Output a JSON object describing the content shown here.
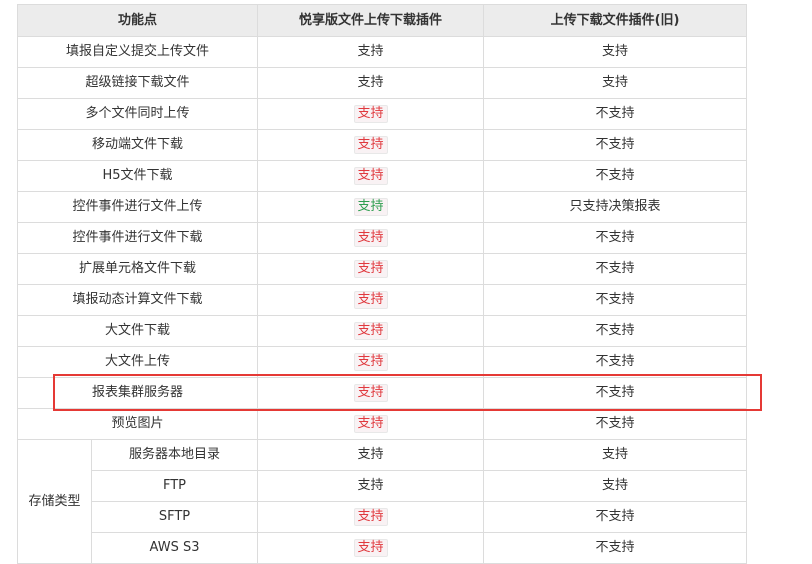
{
  "colors": {
    "text": "#333333",
    "red_support": "#e0393e",
    "green_support": "#2e9e4f",
    "header_bg": "#ececec",
    "border": "#dcdcdc",
    "highlight_box": "#e53935"
  },
  "table": {
    "headers": [
      "功能点",
      "悦享版文件上传下载插件",
      "上传下载文件插件(旧)"
    ],
    "rows": [
      {
        "feature": "填报自定义提交上传文件",
        "new": "支持",
        "new_style": "plain",
        "old": "支持"
      },
      {
        "feature": "超级链接下载文件",
        "new": "支持",
        "new_style": "plain",
        "old": "支持"
      },
      {
        "feature": "多个文件同时上传",
        "new": "支持",
        "new_style": "red",
        "old": "不支持"
      },
      {
        "feature": "移动端文件下载",
        "new": "支持",
        "new_style": "red",
        "old": "不支持"
      },
      {
        "feature": "H5文件下载",
        "new": "支持",
        "new_style": "red",
        "old": "不支持"
      },
      {
        "feature": "控件事件进行文件上传",
        "new": "支持",
        "new_style": "green",
        "old": "只支持决策报表"
      },
      {
        "feature": "控件事件进行文件下载",
        "new": "支持",
        "new_style": "red",
        "old": "不支持"
      },
      {
        "feature": "扩展单元格文件下载",
        "new": "支持",
        "new_style": "red",
        "old": "不支持"
      },
      {
        "feature": "填报动态计算文件下载",
        "new": "支持",
        "new_style": "red",
        "old": "不支持"
      },
      {
        "feature": "大文件下载",
        "new": "支持",
        "new_style": "red",
        "old": "不支持"
      },
      {
        "feature": "大文件上传",
        "new": "支持",
        "new_style": "red",
        "old": "不支持"
      },
      {
        "feature": "报表集群服务器",
        "new": "支持",
        "new_style": "red",
        "old": "不支持",
        "highlighted": true
      },
      {
        "feature": "预览图片",
        "new": "支持",
        "new_style": "red",
        "old": "不支持"
      }
    ],
    "storage_group": {
      "label": "存储类型",
      "rows": [
        {
          "feature": "服务器本地目录",
          "new": "支持",
          "new_style": "plain",
          "old": "支持"
        },
        {
          "feature": "FTP",
          "new": "支持",
          "new_style": "plain",
          "old": "支持"
        },
        {
          "feature": "SFTP",
          "new": "支持",
          "new_style": "red",
          "old": "不支持"
        },
        {
          "feature": "AWS S3",
          "new": "支持",
          "new_style": "red",
          "old": "不支持"
        }
      ]
    }
  }
}
